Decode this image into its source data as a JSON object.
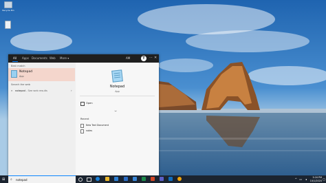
{
  "desktop": {
    "icons": [
      {
        "label": "Recycle Bin",
        "icon": "recycle-bin-icon"
      },
      {
        "label": "",
        "icon": "file-icon"
      }
    ]
  },
  "search_panel": {
    "tabs": [
      "All",
      "Apps",
      "Documents",
      "Web",
      "More ▾"
    ],
    "active_tab": "All",
    "user_initials": "AM",
    "avatar_letter": "T",
    "more_icon": "ellipsis-icon",
    "close_icon": "close-icon",
    "best_match": {
      "header": "Best match",
      "name": "Notepad",
      "type": "App",
      "icon": "notepad-icon"
    },
    "web": {
      "header": "Search the web",
      "query": "notepad",
      "suffix": " - See web results",
      "icon": "search-icon",
      "arrow": "›"
    },
    "detail": {
      "name": "Notepad",
      "type": "App",
      "icon": "notepad-icon",
      "open_label": "Open",
      "recent_header": "Recent",
      "recent_items": [
        "New Text Document",
        "notes"
      ]
    }
  },
  "taskbar": {
    "search_value": "notepad",
    "search_icon": "search-icon",
    "start_icon": "windows-logo-icon",
    "clock_time": "3:16 PM",
    "clock_date": "10/1/2020",
    "colors": {
      "accent": "#0a84ff",
      "bar": "#1b2430"
    }
  }
}
